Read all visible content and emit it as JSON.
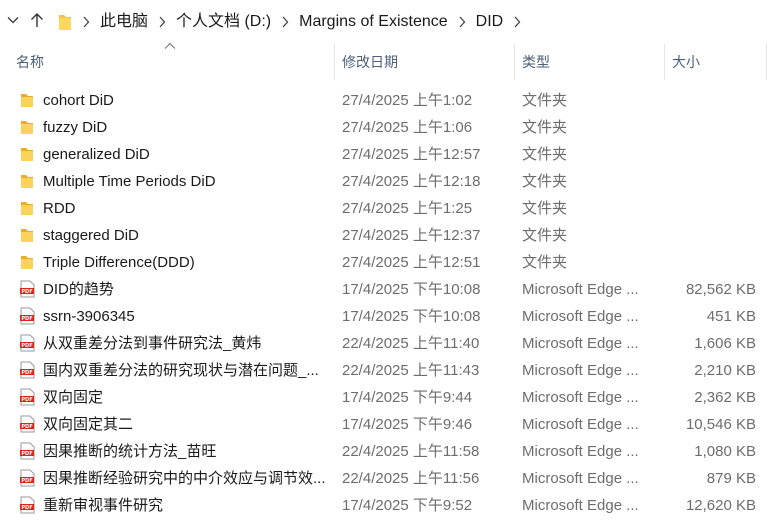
{
  "breadcrumb": [
    "此电脑",
    "个人文档 (D:)",
    "Margins of Existence",
    "DID"
  ],
  "columns": {
    "name": "名称",
    "date": "修改日期",
    "type": "类型",
    "size": "大小"
  },
  "files": [
    {
      "kind": "folder",
      "name": "cohort DiD",
      "date": "27/4/2025 上午1:02",
      "type": "文件夹",
      "size": ""
    },
    {
      "kind": "folder",
      "name": "fuzzy DiD",
      "date": "27/4/2025 上午1:06",
      "type": "文件夹",
      "size": ""
    },
    {
      "kind": "folder",
      "name": "generalized DiD",
      "date": "27/4/2025 上午12:57",
      "type": "文件夹",
      "size": ""
    },
    {
      "kind": "folder",
      "name": "Multiple Time Periods DiD",
      "date": "27/4/2025 上午12:18",
      "type": "文件夹",
      "size": ""
    },
    {
      "kind": "folder",
      "name": "RDD",
      "date": "27/4/2025 上午1:25",
      "type": "文件夹",
      "size": ""
    },
    {
      "kind": "folder",
      "name": "staggered DiD",
      "date": "27/4/2025 上午12:37",
      "type": "文件夹",
      "size": ""
    },
    {
      "kind": "folder",
      "name": "Triple Difference(DDD)",
      "date": "27/4/2025 上午12:51",
      "type": "文件夹",
      "size": ""
    },
    {
      "kind": "pdf",
      "name": "DID的趋势",
      "date": "17/4/2025 下午10:08",
      "type": "Microsoft Edge ...",
      "size": "82,562 KB"
    },
    {
      "kind": "pdf",
      "name": "ssrn-3906345",
      "date": "17/4/2025 下午10:08",
      "type": "Microsoft Edge ...",
      "size": "451 KB"
    },
    {
      "kind": "pdf",
      "name": "从双重差分法到事件研究法_黄炜",
      "date": "22/4/2025 上午11:40",
      "type": "Microsoft Edge ...",
      "size": "1,606 KB"
    },
    {
      "kind": "pdf",
      "name": "国内双重差分法的研究现状与潜在问题_...",
      "date": "22/4/2025 上午11:43",
      "type": "Microsoft Edge ...",
      "size": "2,210 KB"
    },
    {
      "kind": "pdf",
      "name": "双向固定",
      "date": "17/4/2025 下午9:44",
      "type": "Microsoft Edge ...",
      "size": "2,362 KB"
    },
    {
      "kind": "pdf",
      "name": "双向固定其二",
      "date": "17/4/2025 下午9:46",
      "type": "Microsoft Edge ...",
      "size": "10,546 KB"
    },
    {
      "kind": "pdf",
      "name": "因果推断的统计方法_苗旺",
      "date": "22/4/2025 上午11:58",
      "type": "Microsoft Edge ...",
      "size": "1,080 KB"
    },
    {
      "kind": "pdf",
      "name": "因果推断经验研究中的中介效应与调节效...",
      "date": "22/4/2025 上午11:56",
      "type": "Microsoft Edge ...",
      "size": "879 KB"
    },
    {
      "kind": "pdf",
      "name": "重新审视事件研究",
      "date": "17/4/2025 下午9:52",
      "type": "Microsoft Edge ...",
      "size": "12,620 KB"
    }
  ],
  "icons": {
    "folder": "folder-icon",
    "pdf": "pdf-file-icon",
    "up": "up-arrow-icon",
    "dropdown": "chevron-down-icon",
    "separator": "chevron-right-icon"
  },
  "colors": {
    "folder": "#f6c445",
    "pdf_red": "#d9261c",
    "header_text": "#4c607a",
    "secondary_text": "#6d6d6d"
  }
}
